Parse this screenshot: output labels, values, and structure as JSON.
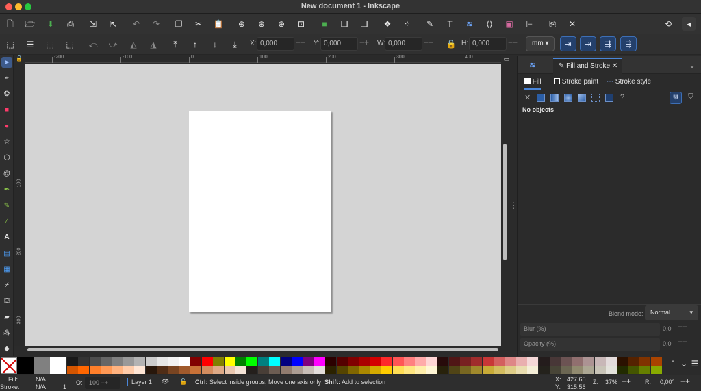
{
  "window": {
    "title": "New document 1 - Inkscape"
  },
  "control_bar": {
    "x_label": "X:",
    "x_value": "0,000",
    "y_label": "Y:",
    "y_value": "0,000",
    "w_label": "W:",
    "w_value": "0,000",
    "h_label": "H:",
    "h_value": "0,000",
    "unit": "mm"
  },
  "rulers": {
    "top": [
      "-200",
      "-100",
      "0",
      "100",
      "200",
      "300",
      "400"
    ],
    "left": [
      "100",
      "200",
      "300"
    ]
  },
  "dock": {
    "tab_label": "Fill and Stroke",
    "subtabs": {
      "fill": "Fill",
      "stroke_paint": "Stroke paint",
      "stroke_style": "Stroke style"
    },
    "no_objects": "No objects",
    "blend_label": "Blend mode:",
    "blend_value": "Normal",
    "blur_label": "Blur (%)",
    "blur_value": "0,0",
    "opacity_label": "Opacity (%)",
    "opacity_value": "0,0"
  },
  "palette": {
    "row1": [
      "#1a1a1a",
      "#333333",
      "#4d4d4d",
      "#666666",
      "#808080",
      "#999999",
      "#b3b3b3",
      "#cccccc",
      "#e6e6e6",
      "#f2f2f2",
      "#ffffff",
      "#800000",
      "#ff0000",
      "#808000",
      "#ffff00",
      "#008000",
      "#00ff00",
      "#008080",
      "#00ffff",
      "#000080",
      "#0000ff",
      "#800080",
      "#ff00ff",
      "#2b0000",
      "#550000",
      "#800000",
      "#aa0000",
      "#d40000",
      "#ff2a2a",
      "#ff5555",
      "#ff8080",
      "#ffaaaa",
      "#ffd5d5",
      "#280b0b",
      "#501616",
      "#782121",
      "#a02c2c",
      "#c83737",
      "#d35f5f",
      "#de8787",
      "#e9afaf",
      "#f4d7d7",
      "#241c1c",
      "#483737",
      "#6c5353",
      "#916f6f",
      "#ac9393",
      "#c8b7b7",
      "#e3dbdb",
      "#2b1100",
      "#552200",
      "#803300",
      "#aa4400"
    ],
    "row2": [
      "#d45500",
      "#ff6600",
      "#ff7f2a",
      "#ff9955",
      "#ffb380",
      "#ffccaa",
      "#ffe6d5",
      "#28170b",
      "#502d16",
      "#784421",
      "#a05a2c",
      "#c87137",
      "#d38d5f",
      "#deaa87",
      "#e9c6af",
      "#f4e3d7",
      "#241f1c",
      "#483e37",
      "#6c5d53",
      "#917c6f",
      "#ac9d93",
      "#c8beb7",
      "#e3dedb",
      "#2b2200",
      "#554400",
      "#806600",
      "#aa8800",
      "#d4aa00",
      "#ffcc00",
      "#ffdd55",
      "#ffe680",
      "#ffeeaa",
      "#fff6d5",
      "#28220b",
      "#504416",
      "#786721",
      "#a0892c",
      "#c8ab37",
      "#d3bc5f",
      "#decd87",
      "#e9ddaf",
      "#f4eed7",
      "#24221c",
      "#484537",
      "#6c6753",
      "#918a6f",
      "#aca793",
      "#c8c4b7",
      "#e3e2db",
      "#222b00",
      "#445500",
      "#668000",
      "#88aa00"
    ]
  },
  "status": {
    "fill_label": "Fill:",
    "fill_value": "N/A",
    "stroke_label": "Stroke:",
    "stroke_value": "N/A",
    "stroke_width": "1",
    "opacity_label": "O:",
    "opacity_value": "100",
    "layer": "Layer 1",
    "message_bold1": "Ctrl:",
    "message_text1": " Select inside groups, Move one axis only; ",
    "message_bold2": "Shift:",
    "message_text2": " Add to selection",
    "x_label": "X:",
    "x_value": "427,65",
    "y_label": "Y:",
    "y_value": "315,56",
    "zoom_label": "Z:",
    "zoom_value": "37%",
    "rotation_label": "R:",
    "rotation_value": "0,00°"
  }
}
